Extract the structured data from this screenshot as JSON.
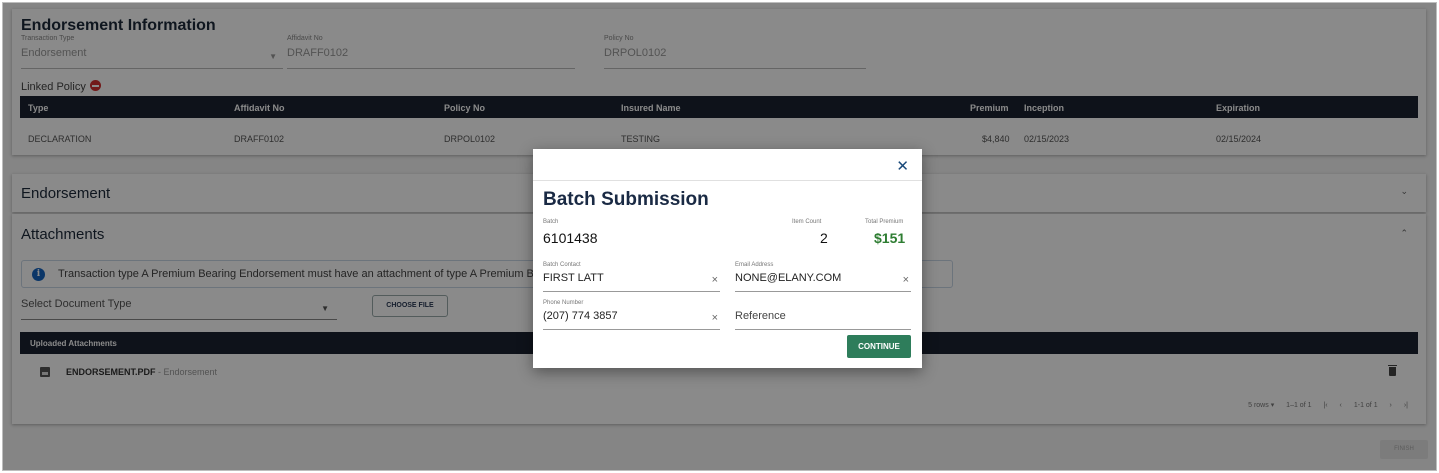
{
  "endorsement_info": {
    "title": "Endorsement Information",
    "transaction_type_label": "Transaction Type",
    "transaction_type_value": "Endorsement",
    "affidavit_label": "Affidavit No",
    "affidavit_value": "DRAFF0102",
    "policy_label": "Policy No",
    "policy_value": "DRPOL0102",
    "linked_policy_label": "Linked Policy"
  },
  "linked_table": {
    "columns": [
      "Type",
      "Affidavit No",
      "Policy No",
      "Insured Name",
      "Premium",
      "Inception",
      "Expiration"
    ],
    "rows": [
      [
        "DECLARATION",
        "DRAFF0102",
        "DRPOL0102",
        "TESTING",
        "$4,840",
        "02/15/2023",
        "02/15/2024"
      ]
    ]
  },
  "endorsement_section": {
    "title": "Endorsement"
  },
  "attachments": {
    "title": "Attachments",
    "info_text": "Transaction type A Premium Bearing Endorsement must have an attachment of type A Premium Beari",
    "select_placeholder": "Select Document Type",
    "choose_file_label": "CHOOSE FILE",
    "uploaded_header": "Uploaded Attachments",
    "file_name": "ENDORSEMENT.PDF",
    "file_type": " - Endorsement",
    "pager": {
      "rows_label": "5 rows",
      "range": "1–1 of 1",
      "page": "1-1 of 1"
    }
  },
  "finish_label": "FINISH",
  "modal": {
    "title": "Batch Submission",
    "batch_label": "Batch",
    "batch_value": "6101438",
    "item_count_label": "Item Count",
    "item_count_value": "2",
    "total_premium_label": "Total Premium",
    "total_premium_value": "$151",
    "batch_contact_label": "Batch Contact",
    "batch_contact_value": "FIRST LATT",
    "email_label": "Email Address",
    "email_value": "NONE@ELANY.COM",
    "phone_label": "Phone Number",
    "phone_value": "(207) 774 3857",
    "reference_placeholder": "Reference",
    "continue_label": "CONTINUE"
  },
  "colors": {
    "header_dark": "#1a2230",
    "accent_green": "#2e7d5b",
    "premium_green": "#2e7d32",
    "info_blue": "#1565c0",
    "danger_red": "#d32f2f"
  }
}
